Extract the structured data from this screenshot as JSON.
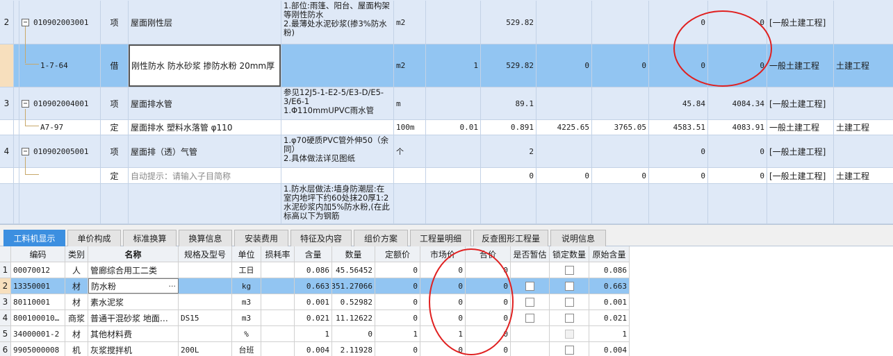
{
  "upper_rows": [
    {
      "index": "2",
      "code": "010902003001",
      "type": "项",
      "name": "屋面刚性层",
      "features": "1.部位:雨篷、阳台、屋面构架等刚性防水\n2.最薄处水泥砂浆(掺3%防水粉)",
      "unit": "m2",
      "expr": "",
      "qty": "529.82",
      "p1": "",
      "p2": "",
      "p3": "0",
      "p4": "0",
      "spec": "[一般土建工程]",
      "prof": ""
    },
    {
      "index": "",
      "code": "1-7-64",
      "type": "借",
      "name": "刚性防水 防水砂浆 掺防水粉 20mm厚",
      "features": "",
      "unit": "m2",
      "expr": "1",
      "qty": "529.82",
      "p1": "0",
      "p2": "0",
      "p3": "0",
      "p4": "0",
      "spec": "一般土建工程",
      "prof": "土建工程"
    },
    {
      "index": "3",
      "code": "010902004001",
      "type": "项",
      "name": "屋面排水管",
      "features": "参见12J5-1-E2-5/E3-D/E5-3/E6-1\n1.Φ110mmUPVC雨水管",
      "unit": "m",
      "expr": "",
      "qty": "89.1",
      "p1": "",
      "p2": "",
      "p3": "45.84",
      "p4": "4084.34",
      "spec": "[一般土建工程]",
      "prof": ""
    },
    {
      "index": "",
      "code": "A7-97",
      "type": "定",
      "name": "屋面排水 塑料水落管 φ110",
      "features": "",
      "unit": "100m",
      "expr": "0.01",
      "qty": "0.891",
      "p1": "4225.65",
      "p2": "3765.05",
      "p3": "4583.51",
      "p4": "4083.91",
      "spec": "一般土建工程",
      "prof": "土建工程"
    },
    {
      "index": "4",
      "code": "010902005001",
      "type": "项",
      "name": "屋面排（透）气管",
      "features": "1.φ70硬质PVC管外伸50（余同）\n2.具体做法详见图纸",
      "unit": "个",
      "expr": "",
      "qty": "2",
      "p1": "",
      "p2": "",
      "p3": "0",
      "p4": "0",
      "spec": "[一般土建工程]",
      "prof": ""
    },
    {
      "index": "",
      "code": "",
      "type": "定",
      "name": "自动提示：请输入子目简称",
      "features": "",
      "unit": "",
      "expr": "",
      "qty": "0",
      "p1": "0",
      "p2": "0",
      "p3": "0",
      "p4": "0",
      "spec": "[一般土建工程]",
      "prof": "土建工程"
    },
    {
      "index": "",
      "code": "",
      "type": "",
      "name": "",
      "features": "1.防水层做法:墙身防潮层:在室内地坪下约60处抹20厚1:2水泥砂浆内加5%防水粉,(在此标高以下为钢筋",
      "unit": "",
      "expr": "",
      "qty": "",
      "p1": "",
      "p2": "",
      "p3": "",
      "p4": "",
      "spec": "",
      "prof": ""
    }
  ],
  "tabs": [
    "工料机显示",
    "单价构成",
    "标准换算",
    "换算信息",
    "安装费用",
    "特征及内容",
    "组价方案",
    "工程量明细",
    "反查图形工程量",
    "说明信息"
  ],
  "lower_headers": [
    "编码",
    "类别",
    "名称",
    "规格及型号",
    "单位",
    "损耗率",
    "含量",
    "数量",
    "定额价",
    "市场价",
    "合价",
    "是否暂估",
    "锁定数量",
    "原始含量"
  ],
  "lower_rows": [
    {
      "index": "1",
      "code": "00070012",
      "cat": "人",
      "name": "管廊综合用工二类",
      "spec": "",
      "unit": "工日",
      "loss": "",
      "content": "0.086",
      "qty": "45.56452",
      "base": "0",
      "market": "0",
      "total": "0",
      "temp": "",
      "lock": "box",
      "orig": "0.086"
    },
    {
      "index": "2",
      "code": "13350001",
      "cat": "材",
      "name": "防水粉",
      "spec": "",
      "unit": "kg",
      "loss": "",
      "content": "0.663",
      "qty": "351.27066",
      "base": "0",
      "market": "0",
      "total": "0",
      "temp": "box",
      "lock": "box",
      "orig": "0.663"
    },
    {
      "index": "3",
      "code": "80110001",
      "cat": "材",
      "name": "素水泥浆",
      "spec": "",
      "unit": "m3",
      "loss": "",
      "content": "0.001",
      "qty": "0.52982",
      "base": "0",
      "market": "0",
      "total": "0",
      "temp": "box",
      "lock": "box",
      "orig": "0.001"
    },
    {
      "index": "4",
      "code": "800100010…",
      "cat": "商浆",
      "name": "普通干混砂浆 地面…",
      "spec": "DS15",
      "unit": "m3",
      "loss": "",
      "content": "0.021",
      "qty": "11.12622",
      "base": "0",
      "market": "0",
      "total": "0",
      "temp": "box",
      "lock": "box",
      "orig": "0.021"
    },
    {
      "index": "5",
      "code": "34000001-2",
      "cat": "材",
      "name": "其他材料费",
      "spec": "",
      "unit": "%",
      "loss": "",
      "content": "1",
      "qty": "0",
      "base": "1",
      "market": "1",
      "total": "0",
      "temp": "",
      "lock": "disabled",
      "orig": "1"
    },
    {
      "index": "6",
      "code": "9905000008",
      "cat": "机",
      "name": "灰浆搅拌机",
      "spec": "200L",
      "unit": "台班",
      "loss": "",
      "content": "0.004",
      "qty": "2.11928",
      "base": "0",
      "market": "0",
      "total": "0",
      "temp": "",
      "lock": "box",
      "orig": "0.004"
    }
  ],
  "colors": {
    "header_blue": "#dfe9f7",
    "selected_row": "#92c5f2",
    "active_tab": "#3c8fe0",
    "annotation_red": "#e02020"
  }
}
